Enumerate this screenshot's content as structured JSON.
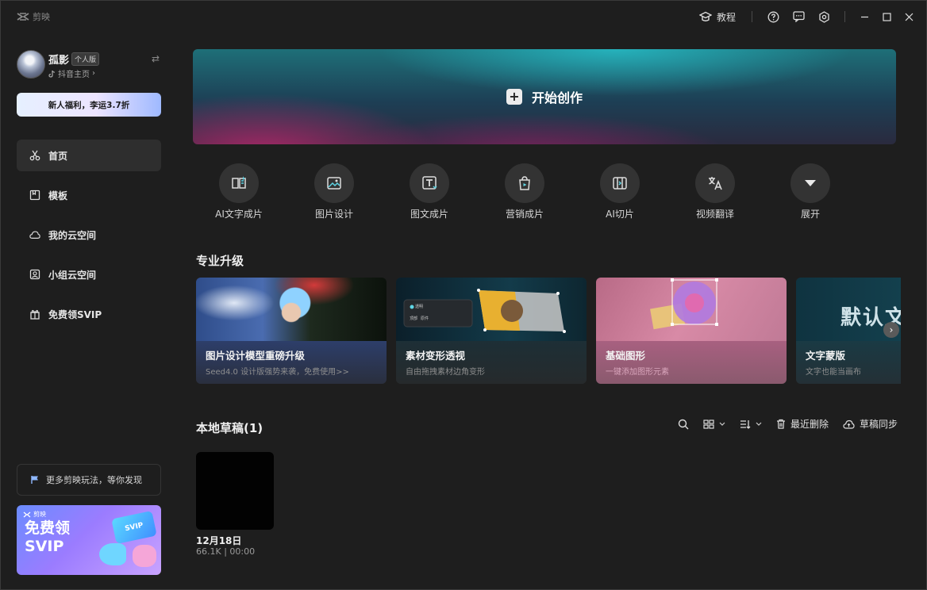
{
  "app": {
    "brand": "剪映"
  },
  "titlebar": {
    "tutorial_label": "教程"
  },
  "user": {
    "name": "孤影",
    "edition": "个人版",
    "douyin_link": "抖音主页"
  },
  "promo": {
    "label": "新人福利，李运3.7折"
  },
  "nav": [
    {
      "label": "首页",
      "icon": "scissors-icon",
      "active": true
    },
    {
      "label": "模板",
      "icon": "template-icon",
      "active": false
    },
    {
      "label": "我的云空间",
      "icon": "cloud-icon",
      "active": false
    },
    {
      "label": "小组云空间",
      "icon": "group-cloud-icon",
      "active": false
    },
    {
      "label": "免费领SVIP",
      "icon": "gift-icon",
      "active": false
    }
  ],
  "discover": {
    "label": "更多剪映玩法，等你发现"
  },
  "svip_banner": {
    "brand": "剪映",
    "title_line1": "免费领",
    "title_line2": "SVIP",
    "ticket": "SVIP"
  },
  "hero": {
    "label": "开始创作"
  },
  "quick_actions": [
    {
      "label": "AI文字成片",
      "icon": "ai-text-video-icon"
    },
    {
      "label": "图片设计",
      "icon": "image-design-icon"
    },
    {
      "label": "图文成片",
      "icon": "image-text-video-icon"
    },
    {
      "label": "营销成片",
      "icon": "marketing-video-icon"
    },
    {
      "label": "AI切片",
      "icon": "ai-slice-icon"
    },
    {
      "label": "视频翻译",
      "icon": "translate-icon"
    },
    {
      "label": "展开",
      "icon": "expand-icon"
    }
  ],
  "pro_upgrade": {
    "title": "专业升级",
    "cards": [
      {
        "title": "图片设计模型重磅升级",
        "subtitle": "Seed4.0 设计版强势来袭，免费使用>>"
      },
      {
        "title": "素材变形透视",
        "subtitle": "自由拖拽素材边角变形",
        "chip1": "透明",
        "chip2": "顶部",
        "chip3": "原件"
      },
      {
        "title": "基础图形",
        "subtitle": "一键添加图形元素"
      },
      {
        "title": "文字蒙版",
        "subtitle": "文字也能当画布",
        "overlay": "默认文"
      }
    ]
  },
  "drafts": {
    "title": "本地草稿(1)",
    "toolbar": {
      "recent_delete": "最近删除",
      "sync": "草稿同步"
    },
    "items": [
      {
        "date": "12月18日",
        "meta": "66.1K | 00:00"
      }
    ]
  }
}
